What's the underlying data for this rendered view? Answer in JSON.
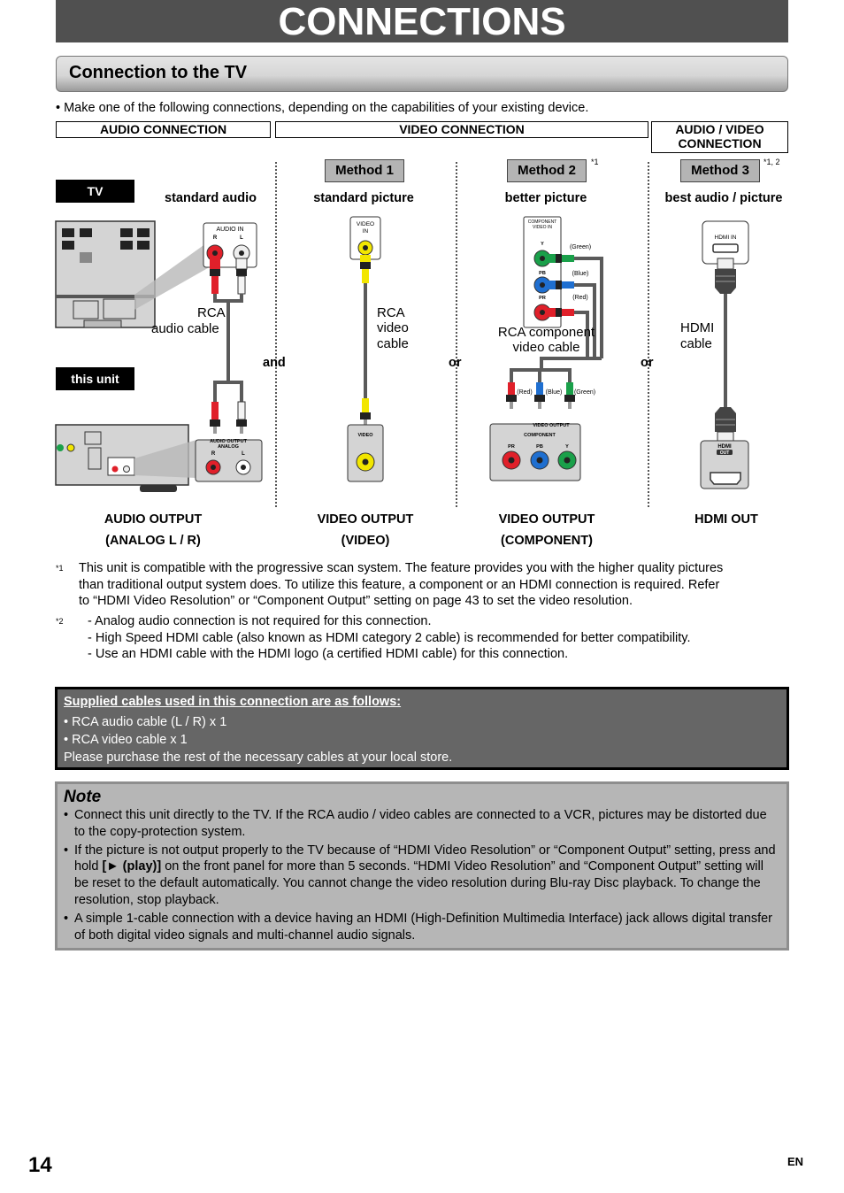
{
  "page": {
    "title": "CONNECTIONS",
    "section_title": "Connection to the TV",
    "intro": "• Make one of the following connections, depending on the capabilities of your existing device.",
    "page_number": "14",
    "language": "EN"
  },
  "headers": {
    "audio": "AUDIO CONNECTION",
    "video": "VIDEO CONNECTION",
    "av_line1": "AUDIO / VIDEO",
    "av_line2": "CONNECTION"
  },
  "methods": [
    {
      "label": "Method 1",
      "footnote": ""
    },
    {
      "label": "Method 2",
      "footnote": "*1"
    },
    {
      "label": "Method 3",
      "footnote": "*1, 2"
    }
  ],
  "devices": {
    "tv": "TV",
    "unit": "this unit"
  },
  "column_captions": {
    "audio": "standard audio",
    "method1": "standard picture",
    "method2": "better picture",
    "method3": "best audio / picture"
  },
  "conjunctions": {
    "and": "and",
    "or1": "or",
    "or2": "or"
  },
  "cables": {
    "rca_audio_l1": "RCA",
    "rca_audio_l2": "audio cable",
    "rca_video_l1": "RCA",
    "rca_video_l2": "video",
    "rca_video_l3": "cable",
    "component_l1": "RCA component",
    "component_l2": "video cable",
    "hdmi_l1": "HDMI",
    "hdmi_l2": "cable"
  },
  "jack_labels": {
    "tv_audio_in": "AUDIO IN",
    "r": "R",
    "l": "L",
    "tv_video_in_1": "VIDEO",
    "tv_video_in_2": "IN",
    "tv_component_1": "COMPONENT",
    "tv_component_2": "VIDEO IN",
    "y": "Y",
    "pb": "PB",
    "pr": "PR",
    "green": "(Green)",
    "blue": "(Blue)",
    "red": "(Red)",
    "hdmi_in": "HDMI IN",
    "unit_audio_out_1": "AUDIO  OUTPUT",
    "unit_audio_out_2": "ANALOG",
    "unit_video": "VIDEO",
    "unit_video_output": "VIDEO OUTPUT",
    "unit_component": "COMPONENT",
    "unit_hdmi": "HDMI",
    "unit_out": "OUT"
  },
  "outputs": {
    "audio_l1": "AUDIO OUTPUT",
    "audio_l2": "(ANALOG L / R)",
    "video_l1": "VIDEO OUTPUT",
    "video_l2": "(VIDEO)",
    "component_l1": "VIDEO OUTPUT",
    "component_l2": "(COMPONENT)",
    "hdmi_l1": "HDMI OUT"
  },
  "footnotes": [
    {
      "mark": "*1",
      "lines": [
        "This unit is compatible with the progressive scan system. The feature provides you with the higher quality pictures",
        "than traditional output system does. To utilize this feature, a component or an HDMI connection is required. Refer",
        "to “HDMI Video Resolution” or “Component Output” setting on page 43 to set the video resolution."
      ]
    },
    {
      "mark": "*2",
      "lines": [
        "- Analog audio connection is not required for this connection.",
        "- High Speed HDMI cable (also known as HDMI category 2 cable) is recommended for better compatibility.",
        "- Use an HDMI cable with the HDMI logo (a certified HDMI cable) for this connection."
      ]
    }
  ],
  "supplied": {
    "heading": "Supplied cables used in this connection are as follows:",
    "items": [
      "• RCA audio cable (L / R) x 1",
      "• RCA video cable x 1"
    ],
    "footer": "Please purchase the rest of the necessary cables at your local store."
  },
  "note": {
    "heading": "Note",
    "items": [
      {
        "text": "Connect this unit directly to the TV. If the RCA audio / video cables are connected to a VCR, pictures may be distorted due to the copy-protection system."
      },
      {
        "pre": "If the picture is not output properly to the TV because of “HDMI Video Resolution” or “Component Output” setting, press and hold ",
        "bold": "[► (play)]",
        "post": " on the front panel for more than 5 seconds. “HDMI Video Resolution” and “Component Output” setting will be reset to the default automatically. You cannot change the video resolution during Blu-ray Disc playback. To change the resolution, stop playback."
      },
      {
        "text": "A simple 1-cable connection with a device having an HDMI (High-Definition Multimedia Interface) jack allows digital transfer of both digital video signals and multi-channel audio signals."
      }
    ]
  },
  "colors": {
    "title_bg": "#505050",
    "supplied_bg": "#666666",
    "note_bg": "#b6b6b6",
    "method_bg": "#b4b4b4",
    "jack_red": "#e0202a",
    "jack_green": "#1aa04a",
    "jack_blue": "#1f6fd0",
    "jack_yellow": "#f2e600",
    "cable_gray": "#5a5a5a"
  }
}
